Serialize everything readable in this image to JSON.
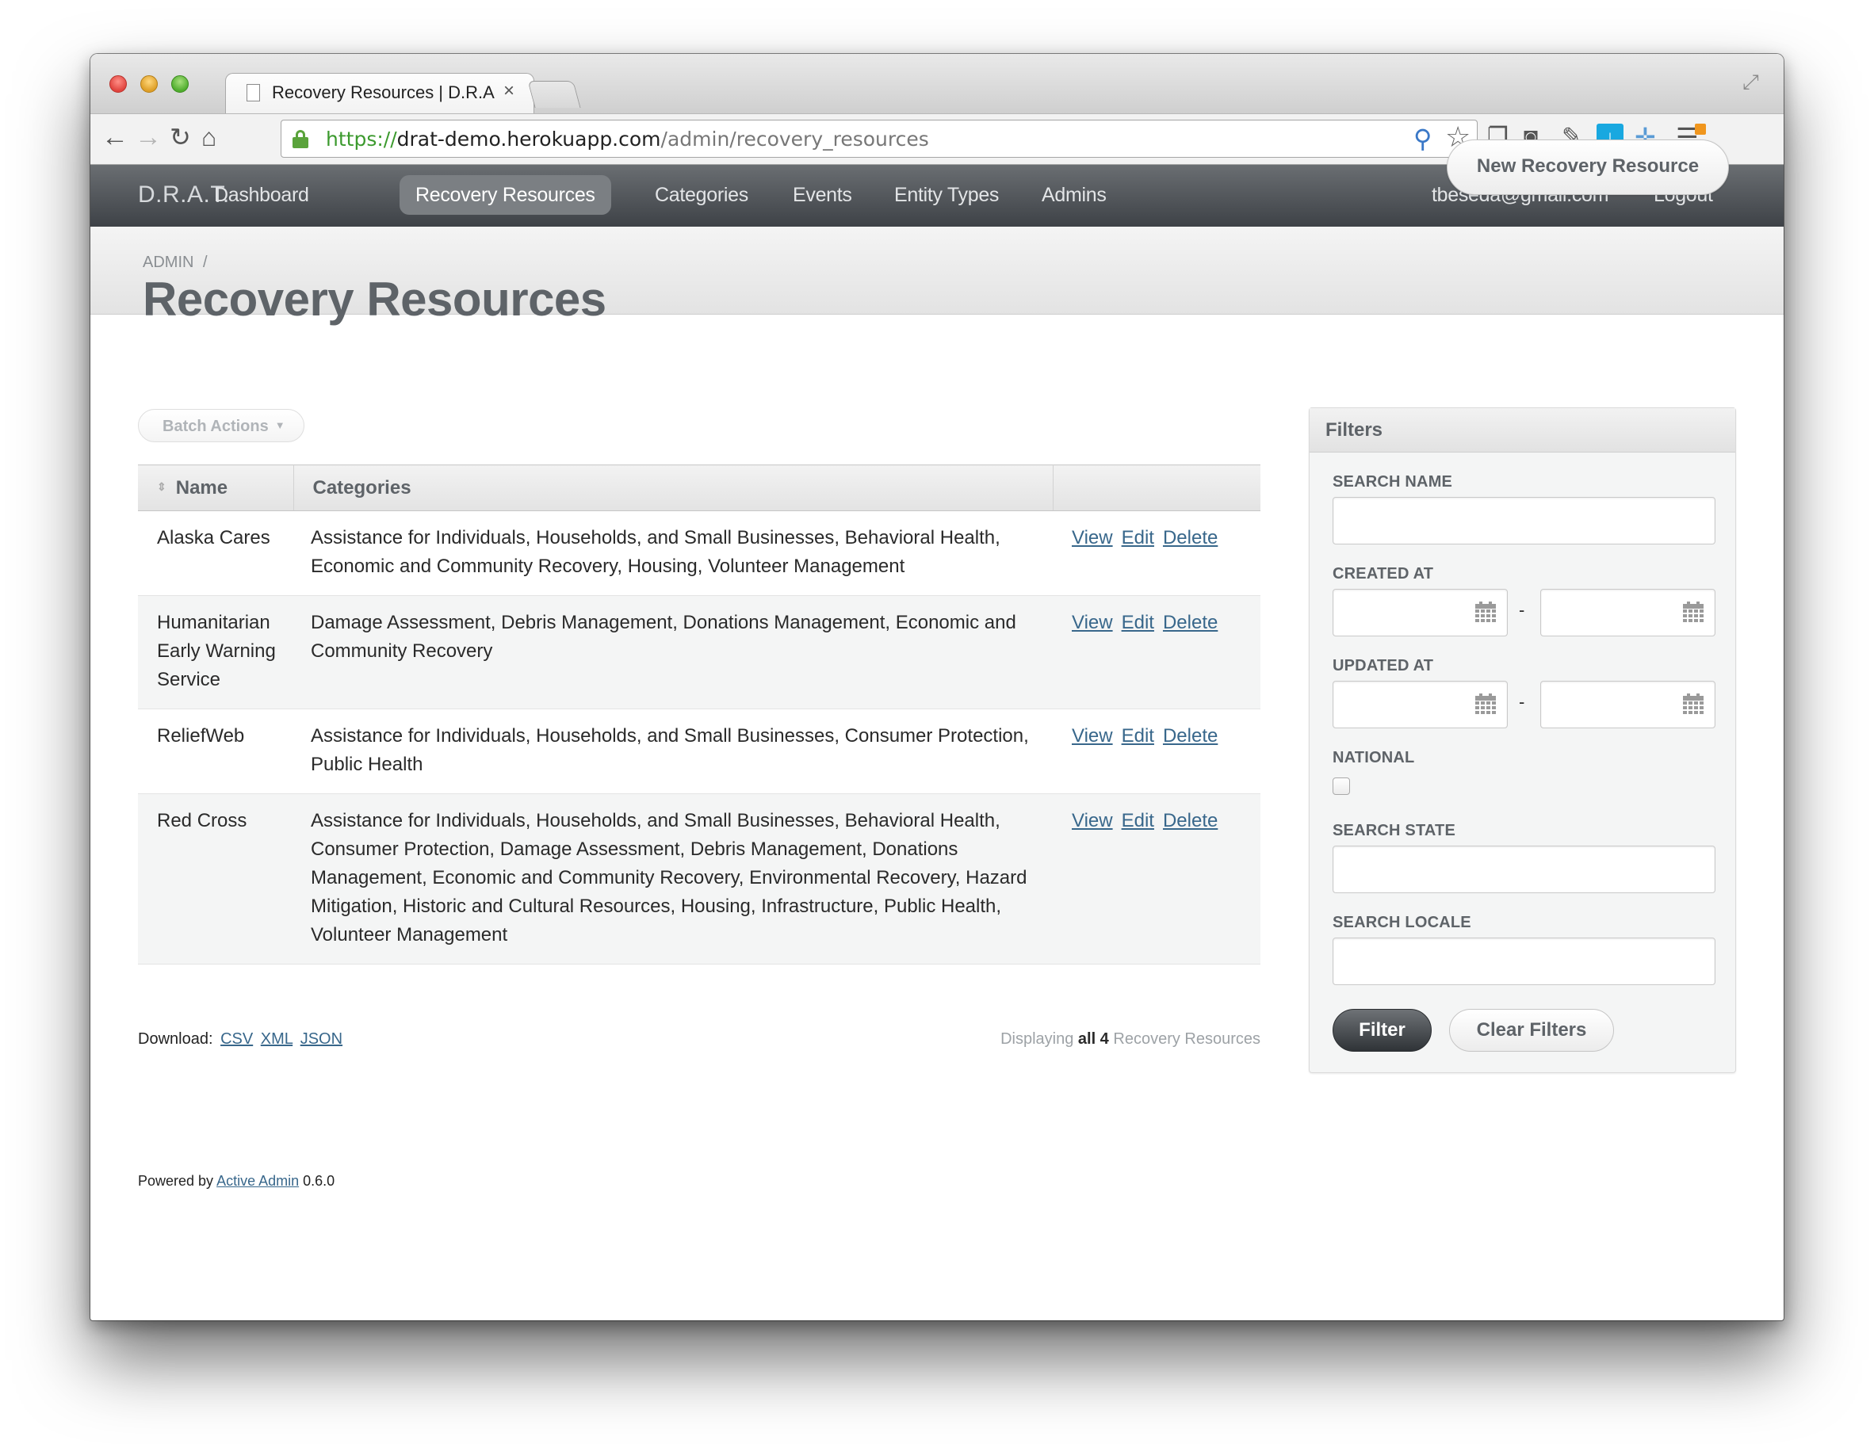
{
  "browser": {
    "tab_title": "Recovery Resources | D.R.A.T.",
    "tab_close": "×",
    "url_scheme": "https://",
    "url_host": "drat-demo.herokuapp.com",
    "url_path": "/admin/recovery_resources",
    "extension_badge": "0"
  },
  "nav": {
    "site_title": "D.R.A.T.",
    "items": [
      {
        "label": "Dashboard"
      },
      {
        "label": "Recovery Resources",
        "active": true
      },
      {
        "label": "Categories"
      },
      {
        "label": "Events"
      },
      {
        "label": "Entity Types"
      },
      {
        "label": "Admins"
      }
    ],
    "user_email": "tbeseda@gmail.com",
    "logout_label": "Logout"
  },
  "title_bar": {
    "breadcrumb": "ADMIN",
    "breadcrumb_sep": "/",
    "title": "Recovery Resources",
    "new_button": "New Recovery Resource"
  },
  "main": {
    "batch_actions": "Batch Actions",
    "columns": {
      "name": "Name",
      "categories": "Categories"
    },
    "action_labels": {
      "view": "View",
      "edit": "Edit",
      "delete": "Delete"
    },
    "rows": [
      {
        "name": "Alaska Cares",
        "categories": "Assistance for Individuals, Households, and Small Businesses, Behavioral Health, Economic and Community Recovery, Housing, Volunteer Management"
      },
      {
        "name": "Humanitarian Early Warning Service",
        "categories": "Damage Assessment, Debris Management, Donations Management, Economic and Community Recovery"
      },
      {
        "name": "ReliefWeb",
        "categories": "Assistance for Individuals, Households, and Small Businesses, Consumer Protection, Public Health"
      },
      {
        "name": "Red Cross",
        "categories": "Assistance for Individuals, Households, and Small Businesses, Behavioral Health, Consumer Protection, Damage Assessment, Debris Management, Donations Management, Economic and Community Recovery, Environmental Recovery, Hazard Mitigation, Historic and Cultural Resources, Housing, Infrastructure, Public Health, Volunteer Management"
      }
    ],
    "download_label": "Download:",
    "download_formats": [
      "CSV",
      "XML",
      "JSON"
    ],
    "pagination": {
      "prefix": "Displaying",
      "count": "all 4",
      "suffix": "Recovery Resources"
    },
    "footer": {
      "prefix": "Powered by",
      "link": "Active Admin",
      "version": "0.6.0"
    }
  },
  "filters": {
    "title": "Filters",
    "search_name_label": "SEARCH NAME",
    "created_at_label": "CREATED AT",
    "updated_at_label": "UPDATED AT",
    "range_sep": "-",
    "national_label": "NATIONAL",
    "search_state_label": "SEARCH STATE",
    "search_locale_label": "SEARCH LOCALE",
    "filter_button": "Filter",
    "clear_button": "Clear Filters"
  }
}
